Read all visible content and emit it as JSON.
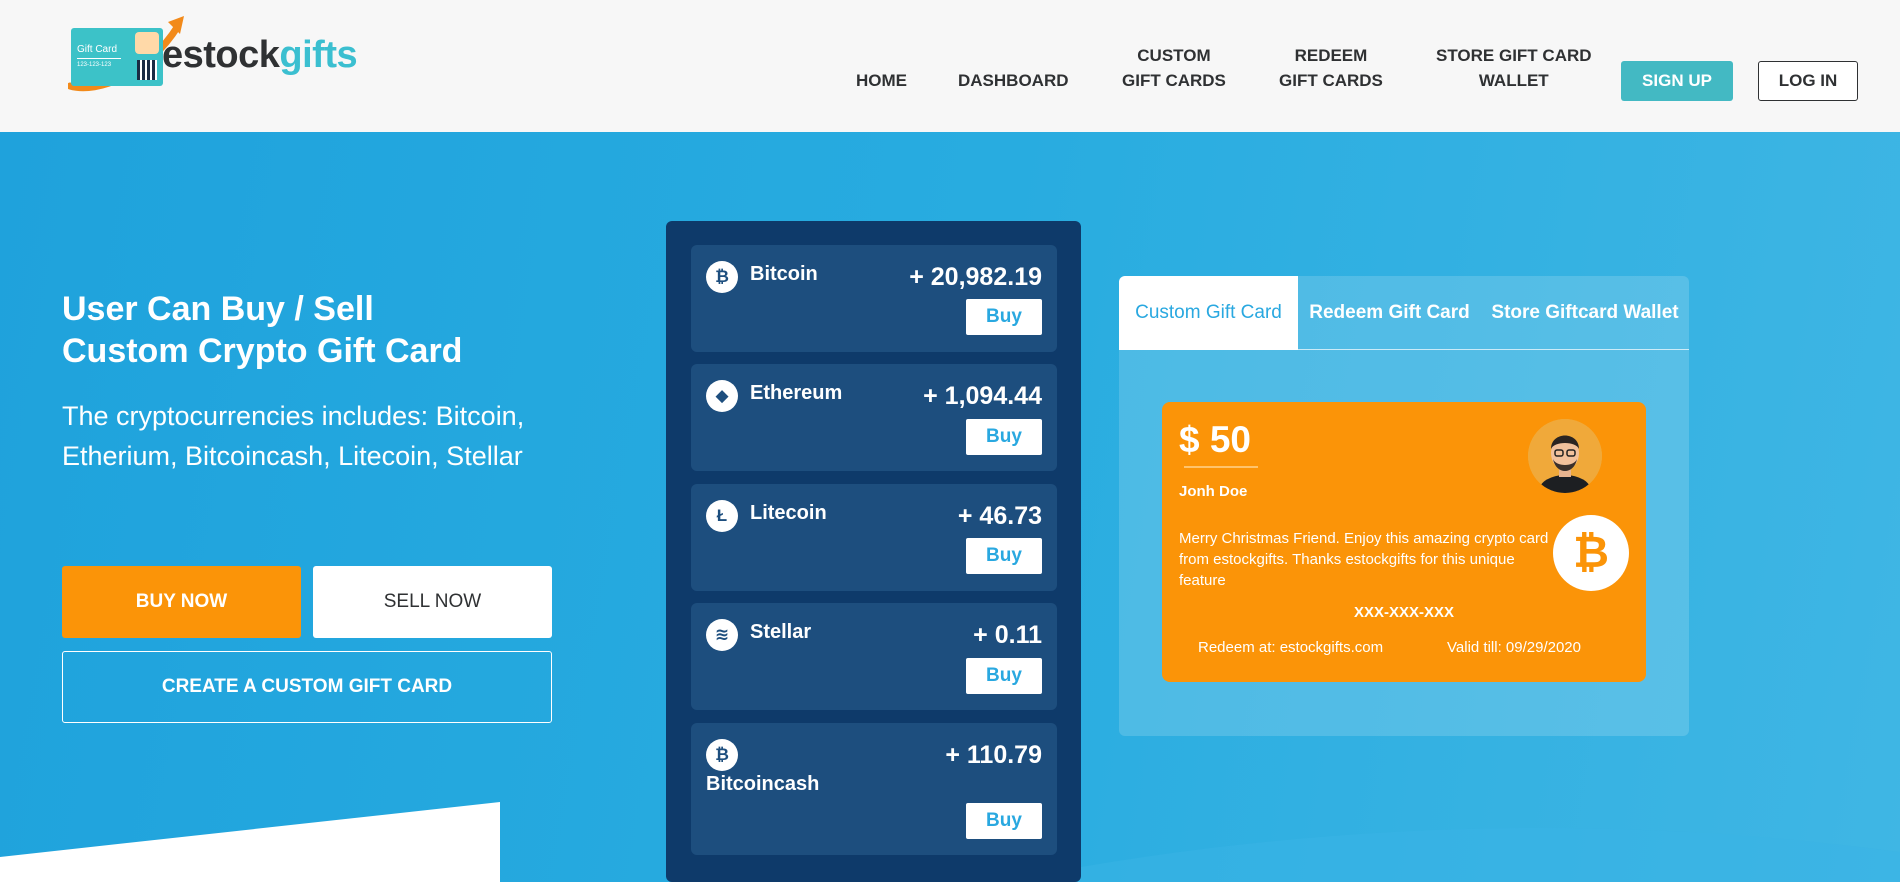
{
  "header": {
    "logo": {
      "word_dark": "estock",
      "word_light": "gifts",
      "card_label": "Gift Card",
      "card_number": "123-123-123"
    },
    "nav": [
      {
        "line1": "HOME",
        "line2": ""
      },
      {
        "line1": "DASHBOARD",
        "line2": ""
      },
      {
        "line1": "CUSTOM",
        "line2": "GIFT CARDS"
      },
      {
        "line1": "REDEEM",
        "line2": "GIFT CARDS"
      },
      {
        "line1": "STORE GIFT CARD",
        "line2": "WALLET"
      }
    ],
    "signup_label": "SIGN UP",
    "login_label": "LOG IN"
  },
  "hero": {
    "title_line1": "User Can Buy / Sell",
    "title_line2": "Custom Crypto Gift Card",
    "subtitle": "The cryptocurrencies includes: Bitcoin, Etherium, Bitcoincash, Litecoin, Stellar",
    "buy_now_label": "BUY NOW",
    "sell_now_label": "SELL NOW",
    "create_label": "CREATE A CUSTOM GIFT CARD"
  },
  "coins": [
    {
      "name": "Bitcoin",
      "value": "+ 20,982.19",
      "icon": "bitcoin-icon",
      "glyph": "₿",
      "buy_label": "Buy"
    },
    {
      "name": "Ethereum",
      "value": "+ 1,094.44",
      "icon": "ethereum-icon",
      "glyph": "◆",
      "buy_label": "Buy"
    },
    {
      "name": "Litecoin",
      "value": "+ 46.73",
      "icon": "litecoin-icon",
      "glyph": "Ł",
      "buy_label": "Buy"
    },
    {
      "name": "Stellar",
      "value": "+ 0.11",
      "icon": "stellar-icon",
      "glyph": "≋",
      "buy_label": "Buy"
    },
    {
      "name": "Bitcoincash",
      "value": "+ 110.79",
      "icon": "bitcoincash-icon",
      "glyph": "₿",
      "buy_label": "Buy"
    }
  ],
  "widget": {
    "tabs": [
      "Custom Gift Card",
      "Redeem Gift Card",
      "Store Giftcard Wallet"
    ],
    "active_tab": "Custom Gift Card",
    "card": {
      "amount": "$ 50",
      "name": "Jonh Doe",
      "message": "Merry Christmas Friend. Enjoy this amazing crypto card from estockgifts. Thanks estockgifts for this unique feature",
      "code": "XXX-XXX-XXX",
      "redeem": "Redeem at: estockgifts.com",
      "valid": "Valid till: 09/29/2020",
      "coin_glyph": "₿"
    }
  },
  "colors": {
    "brand_teal": "#43b9c3",
    "hero_blue": "#1fa2dc",
    "orange": "#fb9408",
    "panel_navy": "#0e3a6a",
    "coin_card": "#1d4e7e"
  }
}
